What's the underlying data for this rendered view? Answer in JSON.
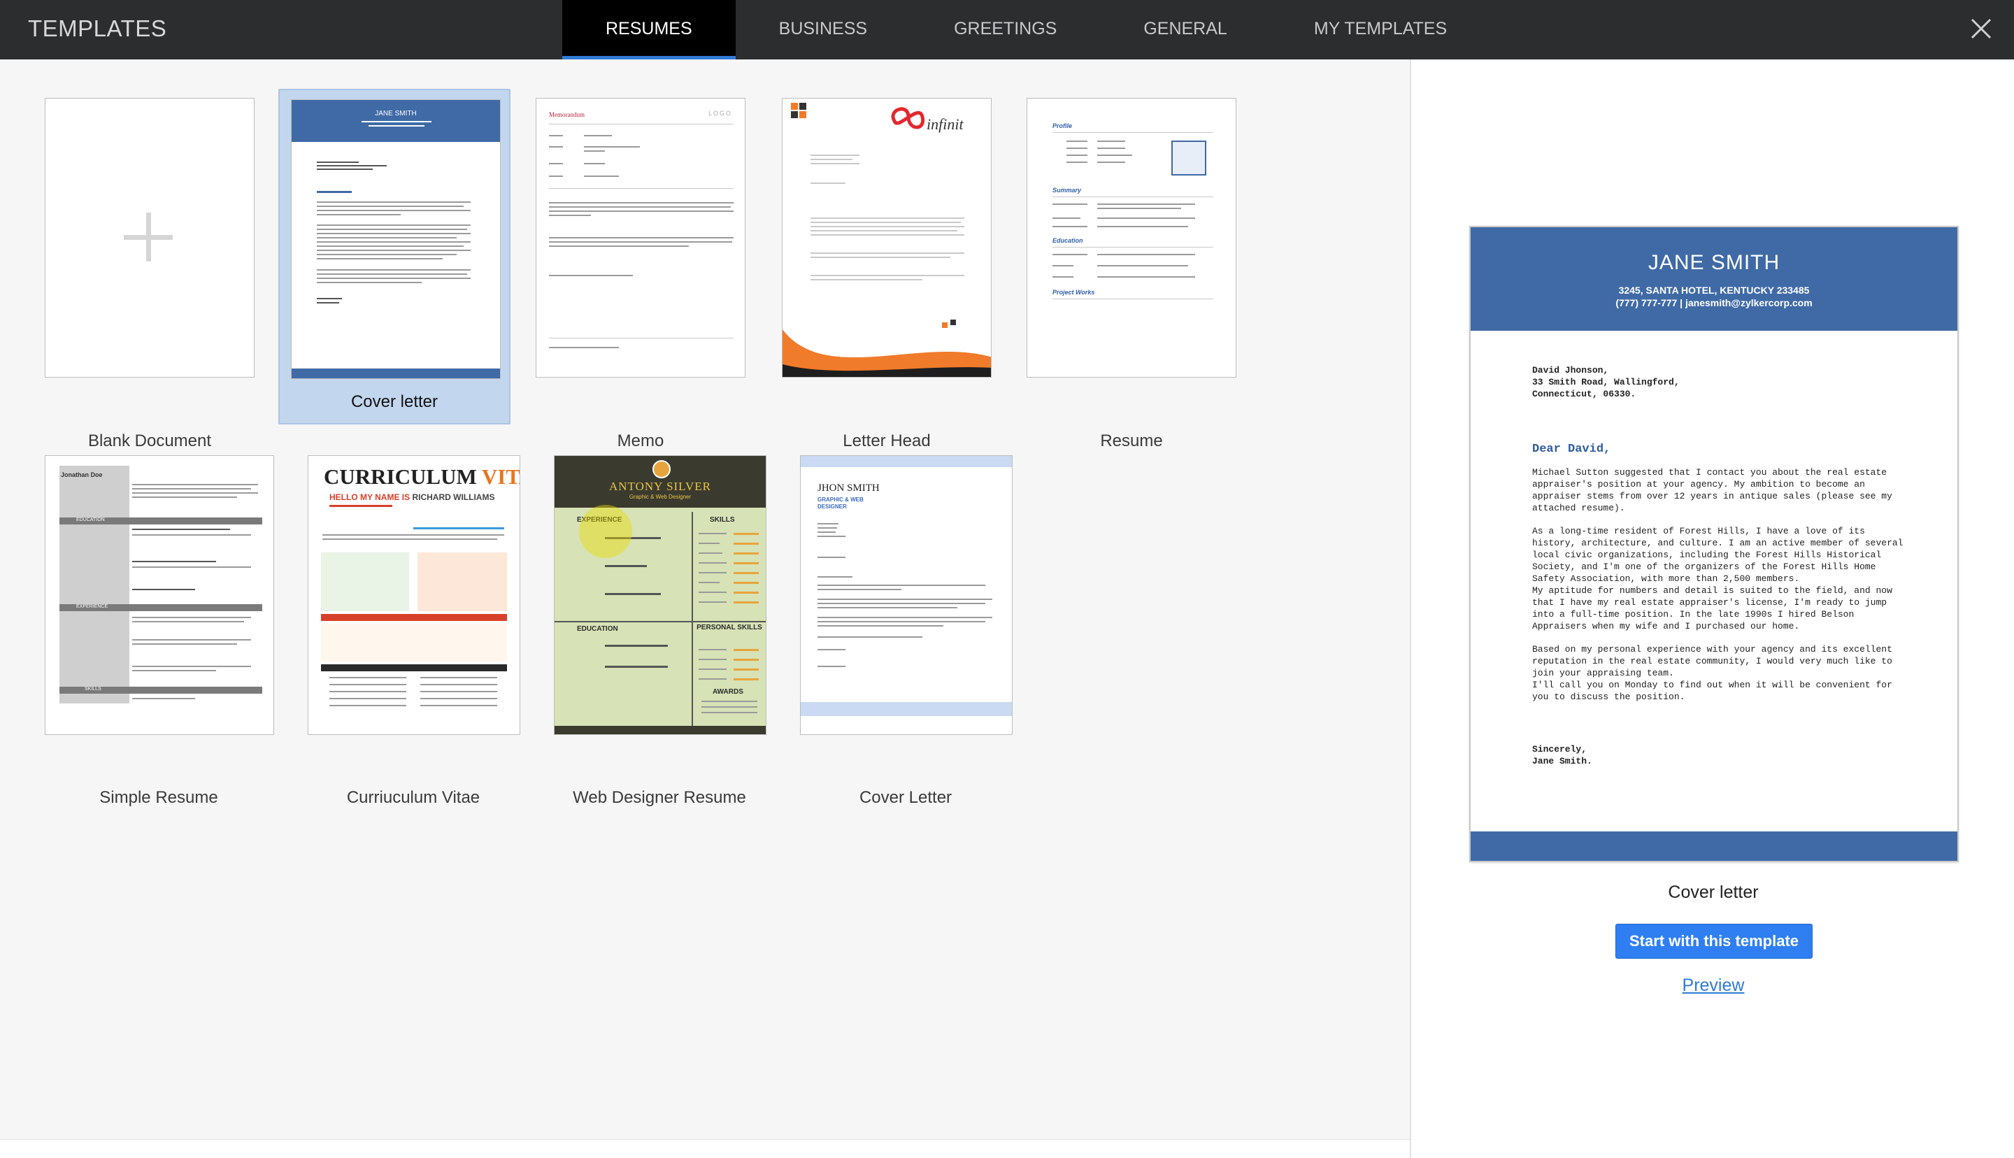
{
  "header": {
    "title": "TEMPLATES",
    "tabs": [
      {
        "label": "RESUMES",
        "active": true
      },
      {
        "label": "BUSINESS",
        "active": false
      },
      {
        "label": "GREETINGS",
        "active": false
      },
      {
        "label": "GENERAL",
        "active": false
      },
      {
        "label": "MY TEMPLATES",
        "active": false
      }
    ],
    "close_icon": "close-icon"
  },
  "templates": [
    {
      "label": "Blank Document",
      "selected": false
    },
    {
      "label": "Cover letter",
      "selected": true
    },
    {
      "label": "Memo",
      "selected": false
    },
    {
      "label": "Letter Head",
      "selected": false
    },
    {
      "label": "Resume",
      "selected": false
    },
    {
      "label": "Simple Resume",
      "selected": false
    },
    {
      "label": "Curriuculum Vitae",
      "selected": false
    },
    {
      "label": "Web Designer Resume",
      "selected": false
    },
    {
      "label": "Cover Letter",
      "selected": false
    }
  ],
  "thumb_text": {
    "cover_name": "JANE SMITH",
    "memo_title": "Memorandum",
    "memo_logo": "LOGO",
    "letterhead_brand": "infinit",
    "resume_profile": "Profile",
    "resume_summary": "Summary",
    "resume_education": "Education",
    "resume_projects": "Project Works",
    "simple_name": "Jonathan Doe",
    "simple_education": "EDUCATION",
    "simple_experience": "EXPERIENCE",
    "simple_skills": "SKILLS",
    "cv_title_a": "CURRICULUM",
    "cv_title_b": "VITAE",
    "cv_hello": "HELLO MY NAME IS",
    "cv_name": "RICHARD WILLIAMS",
    "wd_name": "ANTONY SILVER",
    "wd_role": "Graphic & Web Designer",
    "wd_experience": "EXPERIENCE",
    "wd_skills": "SKILLS",
    "wd_education": "EDUCATION",
    "wd_personal": "PERSONAL SKILLS",
    "wd_awards": "AWARDS",
    "cl2_name": "JHON SMITH",
    "cl2_role": "GRAPHIC & WEB DESIGNER"
  },
  "preview": {
    "name": "JANE SMITH",
    "address": "3245, SANTA HOTEL, KENTUCKY 233485",
    "contact": "(777) 777-777  |  janesmith@zylkercorp.com",
    "recipient": "David Jhonson,\n33 Smith Road, Wallingford,\nConnecticut, 06330.",
    "greeting": "Dear David,",
    "p1": "Michael Sutton suggested that I contact you about the real estate\nappraiser's position at your agency. My ambition to become an\nappraiser stems from over 12 years in antique sales (please see my\nattached resume).",
    "p2": "As a long-time resident of Forest Hills, I have a love of its\nhistory, architecture, and culture. I am an active member of several\nlocal civic organizations, including the Forest Hills Historical\nSociety, and I'm one of the organizers of the Forest Hills Home\nSafety Association, with more than 2,500 members.\nMy aptitude for numbers and detail is suited to the field, and now\nthat I have my real estate appraiser's license, I'm ready to jump\ninto a full-time position. In the late 1990s I hired Belson\nAppraisers when my wife and I purchased our home.",
    "p3": "Based on my personal experience with your agency and its excellent\nreputation in the real estate community, I would very much like to\njoin your appraising team.\nI'll call you on Monday to find out when it will be convenient for\nyou to discuss the position.",
    "signoff": "Sincerely,\nJane Smith.",
    "title": "Cover letter",
    "start_label": "Start with this template",
    "preview_label": "Preview"
  },
  "colors": {
    "header_bg": "#2b2d2f",
    "accent_blue": "#2f7bd5",
    "cover_blue": "#3f6aa6",
    "selected_bg": "#c2d6ee"
  }
}
